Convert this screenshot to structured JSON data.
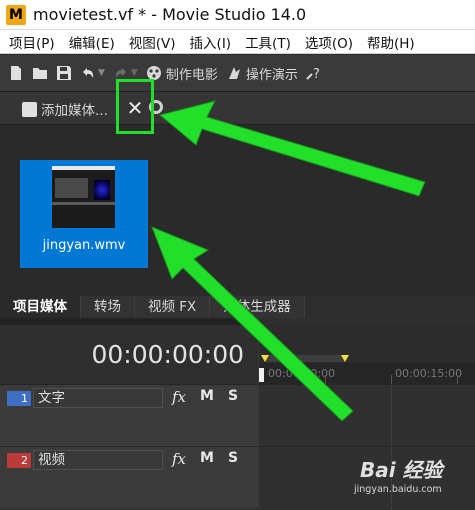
{
  "window": {
    "app_icon_letter": "M",
    "title": "movietest.vf * - Movie Studio 14.0"
  },
  "menu": {
    "items": [
      "项目(P)",
      "编辑(E)",
      "视图(V)",
      "插入(I)",
      "工具(T)",
      "选项(O)",
      "帮助(H)"
    ]
  },
  "toolbar": {
    "icons": [
      "new-icon",
      "open-icon",
      "save-icon",
      "undo-icon",
      "redo-icon"
    ],
    "make_movie_label": "制作电影",
    "show_me_how_label": "操作演示",
    "help_icon": "whats-this-icon"
  },
  "media_panel": {
    "add_media_label": "添加媒体...",
    "close_glyph": "✕",
    "items": [
      {
        "name": "jingyan.wmv",
        "selected": true
      }
    ],
    "tabs": [
      "项目媒体",
      "转场",
      "视频 FX",
      "媒体生成器"
    ],
    "active_tab": "项目媒体"
  },
  "timeline": {
    "timecode": "00:00:00:00",
    "ruler_labels": [
      "00:00:00:00",
      "00:00:15:00"
    ],
    "tracks": [
      {
        "number": "1",
        "name": "文字",
        "type": "video",
        "color": "#3f6fc2"
      },
      {
        "number": "2",
        "name": "视频",
        "type": "video",
        "color": "#bb3a3a"
      }
    ],
    "track_buttons": {
      "fx": "fx",
      "mute": "M",
      "solo": "S"
    }
  },
  "annotations": {
    "highlight_color": "#22e02a"
  },
  "watermark": {
    "logo": "Bai 经验",
    "url": "jingyan.baidu.com"
  }
}
